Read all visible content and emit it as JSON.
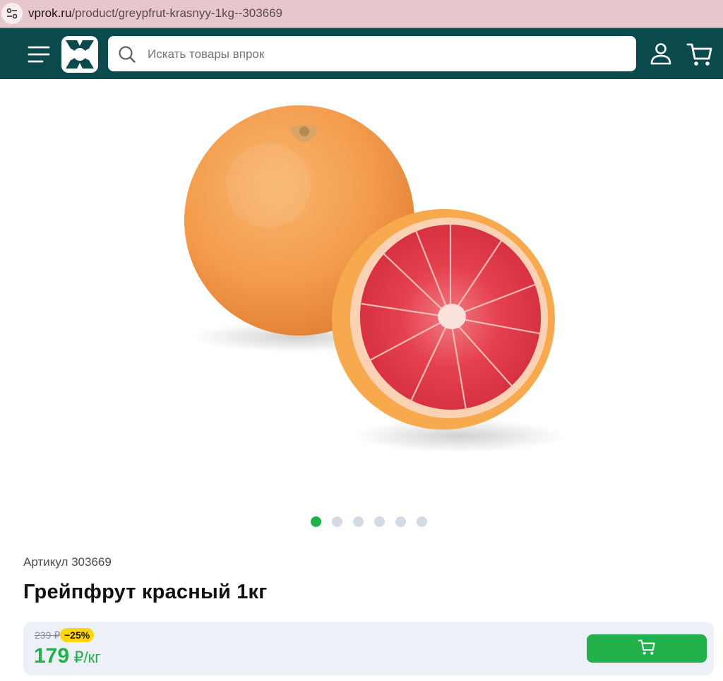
{
  "browser": {
    "url_host": "vprok.ru",
    "url_path": "/product/greypfrut-krasnyy-1kg--303669",
    "icon": "site-settings-icon"
  },
  "header": {
    "menu_icon": "menu-icon",
    "logo_icon": "vprok-logo",
    "search_placeholder": "Искать товары впрок",
    "user_icon": "user-icon",
    "cart_icon": "cart-icon",
    "bg_color": "#0a4a4d"
  },
  "gallery": {
    "image": "grapefruit-photo",
    "dots_total": 6,
    "active_dot": 1,
    "active_color": "#22b04b"
  },
  "product": {
    "sku_label": "Артикул 303669",
    "title": "Грейпфрут красный 1кг"
  },
  "price": {
    "old_price": "239 ₽",
    "discount": "−25%",
    "current_value": "179",
    "current_unit": "₽/кг",
    "accent_color": "#22b04b",
    "badge_color": "#ffd60a"
  },
  "actions": {
    "add_to_cart_icon": "cart-icon"
  }
}
